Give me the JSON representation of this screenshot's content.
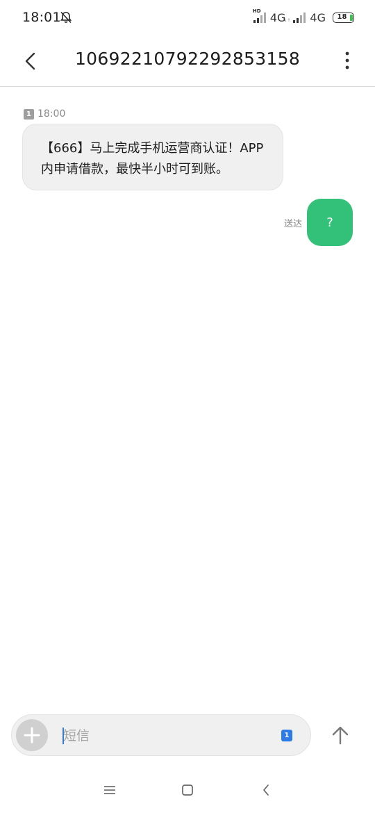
{
  "status_bar": {
    "time": "18:01",
    "network_1": "4G",
    "network_2": "4G",
    "hd_label": "HD",
    "battery": "18",
    "battery_fraction": 0.18,
    "icons": [
      "alarm-off-icon",
      "signal-icon",
      "signal-icon",
      "battery-icon"
    ]
  },
  "header": {
    "title": "1069221079229285315 8",
    "icons": [
      "back-arrow-icon",
      "more-vertical-icon"
    ]
  },
  "messages": [
    {
      "direction": "incoming",
      "sim": "1",
      "time": "18:00",
      "text": "【666】马上完成手机运营商认证！APP内申请借款，最快半小时可到账。"
    },
    {
      "direction": "outgoing",
      "status": "送达",
      "text": "?"
    }
  ],
  "composer": {
    "placeholder": "短信",
    "sim": "1",
    "icons": [
      "plus-icon",
      "send-arrow-up-icon"
    ]
  },
  "colors": {
    "outgoing_bubble": "#33c17a",
    "incoming_bubble": "#f0f0f0",
    "sim_badge": "#2f7be6",
    "battery_green": "#3fc24d"
  },
  "nav_bar": {
    "icons": [
      "menu-icon",
      "home-square-icon",
      "back-chevron-icon"
    ]
  }
}
